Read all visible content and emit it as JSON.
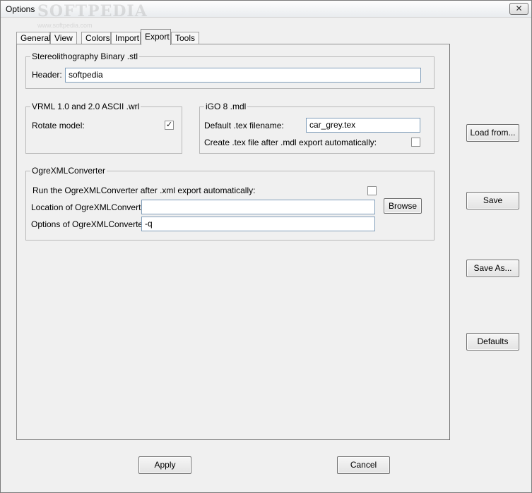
{
  "window": {
    "title": "Options",
    "close_glyph": "✕",
    "watermark": "SOFTPEDIA",
    "watermark_url": "www.softpedia.com"
  },
  "tabs": [
    {
      "label": "General"
    },
    {
      "label": "View"
    },
    {
      "label": "Colors"
    },
    {
      "label": "Import"
    },
    {
      "label": "Export",
      "active": true
    },
    {
      "label": "Tools"
    }
  ],
  "stl": {
    "title": "Stereolithography Binary .stl",
    "header_label": "Header:",
    "header_value": "softpedia"
  },
  "vrml": {
    "title": "VRML 1.0 and 2.0 ASCII .wrl",
    "rotate_label": "Rotate model:",
    "rotate_checked": "✓"
  },
  "igo": {
    "title": "iGO 8 .mdl",
    "tex_label": "Default .tex filename:",
    "tex_value": "car_grey.tex",
    "create_label": "Create .tex file after .mdl export automatically:",
    "create_checked": ""
  },
  "ogre": {
    "title": "OgreXMLConverter",
    "run_label": "Run the OgreXMLConverter after .xml export automatically:",
    "run_checked": "",
    "location_label": "Location of OgreXMLConverter:",
    "location_value": "",
    "browse_label": "Browse",
    "options_label": "Options of OgreXMLConverter:",
    "options_value": "-q"
  },
  "side_buttons": {
    "load": "Load from...",
    "save": "Save",
    "save_as": "Save As...",
    "defaults": "Defaults"
  },
  "footer": {
    "apply": "Apply",
    "cancel": "Cancel"
  },
  "colors": {
    "field_border": "#7f9db9",
    "window_bg": "#f0f0f0"
  }
}
